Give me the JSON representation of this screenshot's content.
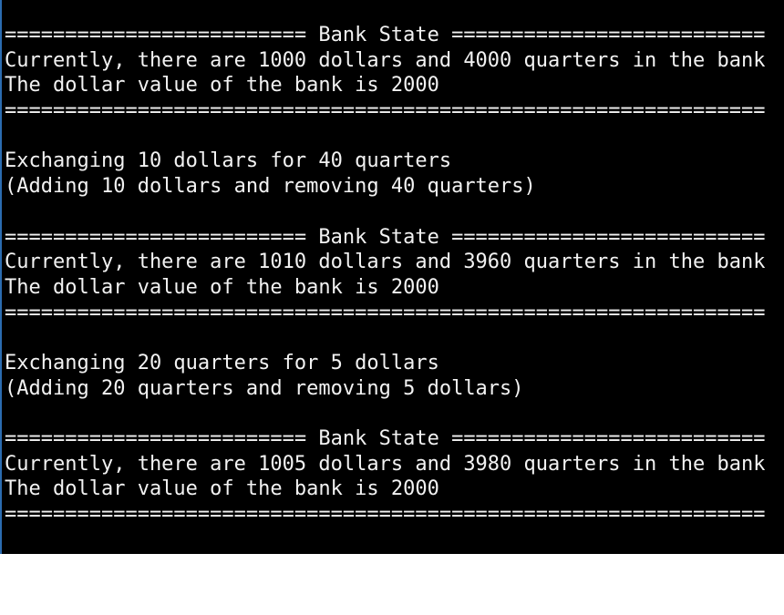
{
  "console": {
    "lines": [
      "========================= Bank State ==========================",
      "Currently, there are 1000 dollars and 4000 quarters in the bank",
      "The dollar value of the bank is 2000",
      "===============================================================",
      "",
      "Exchanging 10 dollars for 40 quarters",
      "(Adding 10 dollars and removing 40 quarters)",
      "",
      "========================= Bank State ==========================",
      "Currently, there are 1010 dollars and 3960 quarters in the bank",
      "The dollar value of the bank is 2000",
      "===============================================================",
      "",
      "Exchanging 20 quarters for 5 dollars",
      "(Adding 20 quarters and removing 5 dollars)",
      "",
      "========================= Bank State ==========================",
      "Currently, there are 1005 dollars and 3980 quarters in the bank",
      "The dollar value of the bank is 2000",
      "==============================================================="
    ]
  }
}
